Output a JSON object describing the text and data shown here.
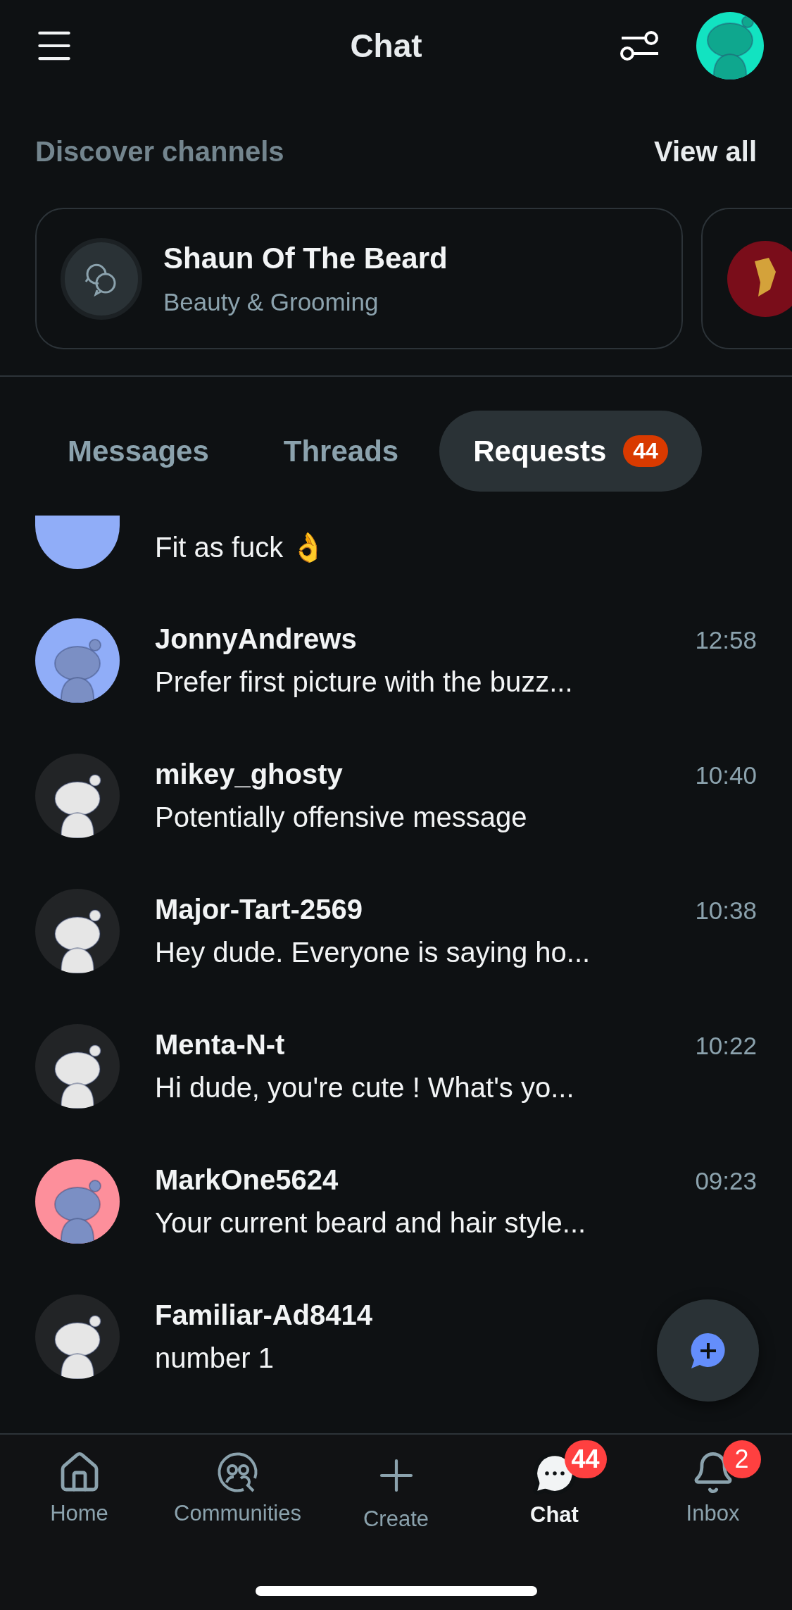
{
  "header": {
    "title": "Chat"
  },
  "discover": {
    "title": "Discover channels",
    "action": "View all",
    "channels": [
      {
        "kind": "chat",
        "name": "Shaun Of The Beard",
        "category": "Beauty & Grooming"
      },
      {
        "kind": "logo"
      }
    ]
  },
  "tabs": [
    {
      "label": "Messages",
      "selected": false
    },
    {
      "label": "Threads",
      "selected": false
    },
    {
      "label": "Requests",
      "selected": true,
      "badge": "44"
    }
  ],
  "conversations": [
    {
      "color": "#90adf8",
      "message": "Fit as fuck 👌"
    },
    {
      "color": "#90adf8",
      "name": "JonnyAndrews",
      "time": "12:58",
      "message": "Prefer first picture with the buzz..."
    },
    {
      "color": "#222426",
      "name": "mikey_ghosty",
      "time": "10:40",
      "message": "Potentially offensive message"
    },
    {
      "color": "#222426",
      "name": "Major-Tart-2569",
      "time": "10:38",
      "message": "Hey dude. Everyone is saying ho..."
    },
    {
      "color": "#222426",
      "name": "Menta-N-t",
      "time": "10:22",
      "message": "Hi dude, you're cute ! What's yo..."
    },
    {
      "color": "#fd8f9b",
      "name": "MarkOne5624",
      "time": "09:23",
      "message": "Your current beard and hair style..."
    },
    {
      "color": "#222426",
      "name": "Familiar-Ad8414",
      "message": "number 1"
    }
  ],
  "nav": [
    {
      "kind": "home",
      "label": "Home",
      "selected": false
    },
    {
      "kind": "communities",
      "label": "Communities",
      "selected": false
    },
    {
      "kind": "create",
      "label": "Create",
      "selected": false
    },
    {
      "kind": "chat",
      "label": "Chat",
      "selected": true,
      "badge": "44"
    },
    {
      "kind": "inbox",
      "label": "Inbox",
      "selected": false,
      "badge": "2"
    }
  ]
}
